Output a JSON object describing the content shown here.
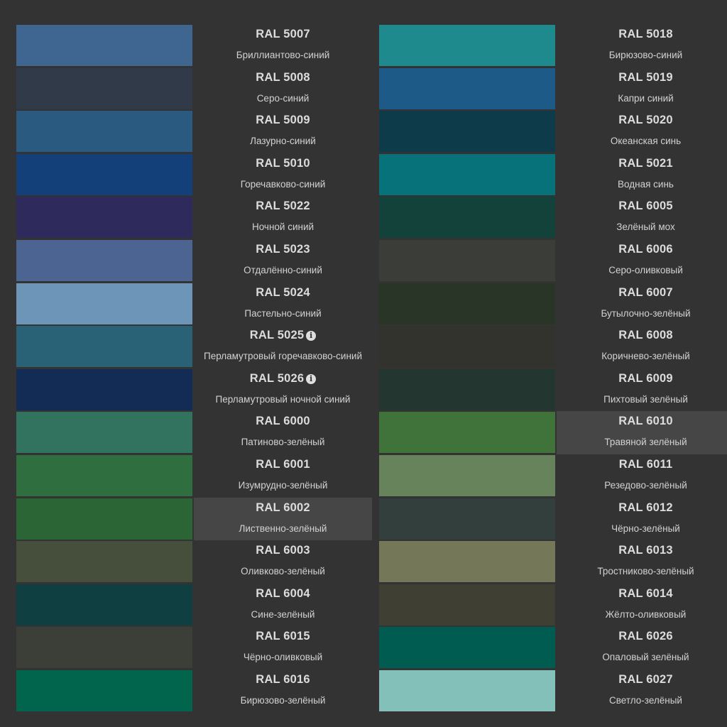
{
  "left_column": [
    {
      "code": "RAL 5007",
      "name": "Бриллиантово-синий",
      "color": "#3f6591",
      "info": false,
      "highlighted": false
    },
    {
      "code": "RAL 5008",
      "name": "Серо-синий",
      "color": "#303a48",
      "info": false,
      "highlighted": false
    },
    {
      "code": "RAL 5009",
      "name": "Лазурно-синий",
      "color": "#2a5a80",
      "info": false,
      "highlighted": false
    },
    {
      "code": "RAL 5010",
      "name": "Горечавково-синий",
      "color": "#14407a",
      "info": false,
      "highlighted": false
    },
    {
      "code": "RAL 5022",
      "name": "Ночной синий",
      "color": "#2e2a5c",
      "info": false,
      "highlighted": false
    },
    {
      "code": "RAL 5023",
      "name": "Отдалённо-синий",
      "color": "#4b6491",
      "info": false,
      "highlighted": false
    },
    {
      "code": "RAL 5024",
      "name": "Пастельно-синий",
      "color": "#6c95b8",
      "info": false,
      "highlighted": false
    },
    {
      "code": "RAL 5025",
      "name": "Перламутровый горечавково-синий",
      "color": "#296277",
      "info": true,
      "highlighted": false
    },
    {
      "code": "RAL 5026",
      "name": "Перламутровый ночной синий",
      "color": "#122c55",
      "info": true,
      "highlighted": false
    },
    {
      "code": "RAL 6000",
      "name": "Патиново-зелёный",
      "color": "#32735f",
      "info": false,
      "highlighted": false
    },
    {
      "code": "RAL 6001",
      "name": "Изумрудно-зелёный",
      "color": "#2f6e3f",
      "info": false,
      "highlighted": false
    },
    {
      "code": "RAL 6002",
      "name": "Лиственно-зелёный",
      "color": "#2b6536",
      "info": false,
      "highlighted": true
    },
    {
      "code": "RAL 6003",
      "name": "Оливково-зелёный",
      "color": "#454f3b",
      "info": false,
      "highlighted": false
    },
    {
      "code": "RAL 6004",
      "name": "Сине-зелёный",
      "color": "#0f3f41",
      "info": false,
      "highlighted": false
    },
    {
      "code": "RAL 6015",
      "name": "Чёрно-оливковый",
      "color": "#3c3f38",
      "info": false,
      "highlighted": false
    },
    {
      "code": "RAL 6016",
      "name": "Бирюзово-зелёный",
      "color": "#00654c",
      "info": false,
      "highlighted": false
    }
  ],
  "right_column": [
    {
      "code": "RAL 5018",
      "name": "Бирюзово-синий",
      "color": "#1f8a8d",
      "info": false,
      "highlighted": false
    },
    {
      "code": "RAL 5019",
      "name": "Капри синий",
      "color": "#1d5a88",
      "info": false,
      "highlighted": false
    },
    {
      "code": "RAL 5020",
      "name": "Океанская синь",
      "color": "#0e3b4a",
      "info": false,
      "highlighted": false
    },
    {
      "code": "RAL 5021",
      "name": "Водная синь",
      "color": "#077279",
      "info": false,
      "highlighted": false
    },
    {
      "code": "RAL 6005",
      "name": "Зелёный мох",
      "color": "#13423a",
      "info": false,
      "highlighted": false
    },
    {
      "code": "RAL 6006",
      "name": "Серо-оливковый",
      "color": "#3b3e38",
      "info": false,
      "highlighted": false
    },
    {
      "code": "RAL 6007",
      "name": "Бутылочно-зелёный",
      "color": "#293527",
      "info": false,
      "highlighted": false
    },
    {
      "code": "RAL 6008",
      "name": "Коричнево-зелёный",
      "color": "#31332c",
      "info": false,
      "highlighted": false
    },
    {
      "code": "RAL 6009",
      "name": "Пихтовый зелёный",
      "color": "#233630",
      "info": false,
      "highlighted": false
    },
    {
      "code": "RAL 6010",
      "name": "Травяной зелёный",
      "color": "#3f7339",
      "info": false,
      "highlighted": true
    },
    {
      "code": "RAL 6011",
      "name": "Резедово-зелёный",
      "color": "#66835c",
      "info": false,
      "highlighted": false
    },
    {
      "code": "RAL 6012",
      "name": "Чёрно-зелёный",
      "color": "#323f3d",
      "info": false,
      "highlighted": false
    },
    {
      "code": "RAL 6013",
      "name": "Тростниково-зелёный",
      "color": "#747858",
      "info": false,
      "highlighted": false
    },
    {
      "code": "RAL 6014",
      "name": "Жёлто-оливковый",
      "color": "#403f33",
      "info": false,
      "highlighted": false
    },
    {
      "code": "RAL 6026",
      "name": "Опаловый зелёный",
      "color": "#005c50",
      "info": false,
      "highlighted": false
    },
    {
      "code": "RAL 6027",
      "name": "Светло-зелёный",
      "color": "#83c0ba",
      "info": false,
      "highlighted": false
    }
  ]
}
